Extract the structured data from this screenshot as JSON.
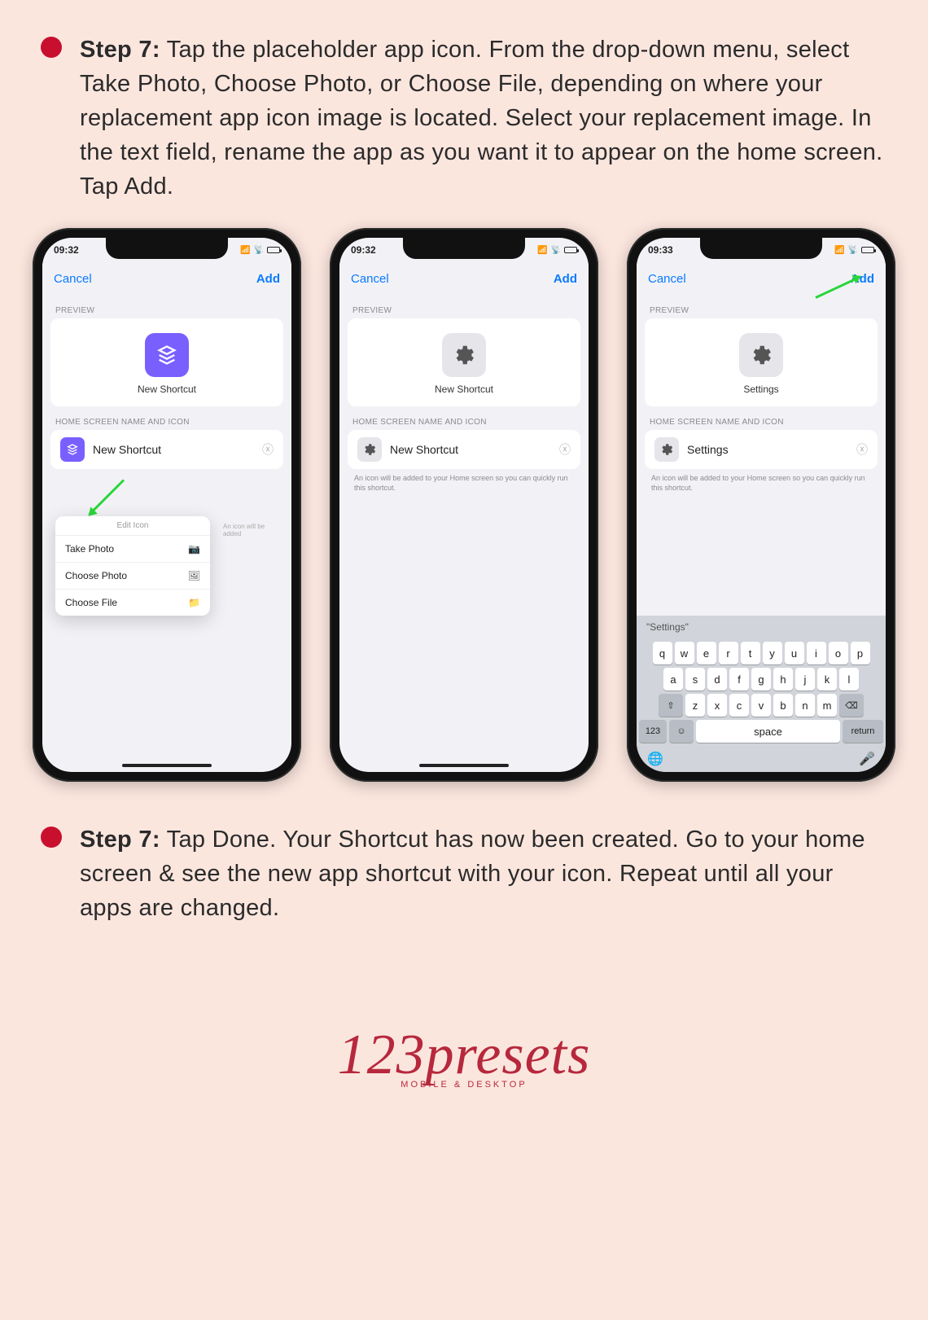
{
  "step_a": {
    "label": "Step 7:",
    "text": "Tap the placeholder app icon. From the drop-down menu, select Take Photo, Choose Photo, or Choose File, depending on where your replacement app icon image is located. Select your replacement image. In the text field, rename the app as you want it to appear on the home screen. Tap Add."
  },
  "phones": {
    "status": {
      "time_a": "09:32",
      "time_b": "09:32",
      "time_c": "09:33"
    },
    "nav": {
      "cancel": "Cancel",
      "add": "Add"
    },
    "section": {
      "preview": "PREVIEW",
      "home": "HOME SCREEN NAME AND ICON"
    },
    "p1": {
      "preview_name": "New Shortcut",
      "input_value": "New Shortcut",
      "menu_title": "Edit Icon",
      "menu": {
        "take": "Take Photo",
        "choose_photo": "Choose Photo",
        "choose_file": "Choose File"
      },
      "side_hint": "An icon will be added"
    },
    "p2": {
      "preview_name": "New Shortcut",
      "input_value": "New Shortcut",
      "helper": "An icon will be added to your Home screen so you can quickly run this shortcut."
    },
    "p3": {
      "preview_name": "Settings",
      "input_value": "Settings",
      "helper": "An icon will be added to your Home screen so you can quickly run this shortcut.",
      "suggestion": "\"Settings\"",
      "kb_rows": {
        "r1": [
          "q",
          "w",
          "e",
          "r",
          "t",
          "y",
          "u",
          "i",
          "o",
          "p"
        ],
        "r2": [
          "a",
          "s",
          "d",
          "f",
          "g",
          "h",
          "j",
          "k",
          "l"
        ],
        "r3": [
          "z",
          "x",
          "c",
          "v",
          "b",
          "n",
          "m"
        ]
      },
      "kb_fn": {
        "shift": "⇧",
        "del": "⌫",
        "nums": "123",
        "emoji": "☺",
        "space": "space",
        "return": "return",
        "globe": "🌐",
        "mic": "🎤"
      }
    }
  },
  "step_b": {
    "label": "Step 7:",
    "text": "Tap Done. Your Shortcut has now been created. Go to your home screen & see the new app shortcut with your icon. Repeat until all your apps are changed."
  },
  "logo": {
    "main": "123presets",
    "sub": "MOBILE & DESKTOP"
  }
}
